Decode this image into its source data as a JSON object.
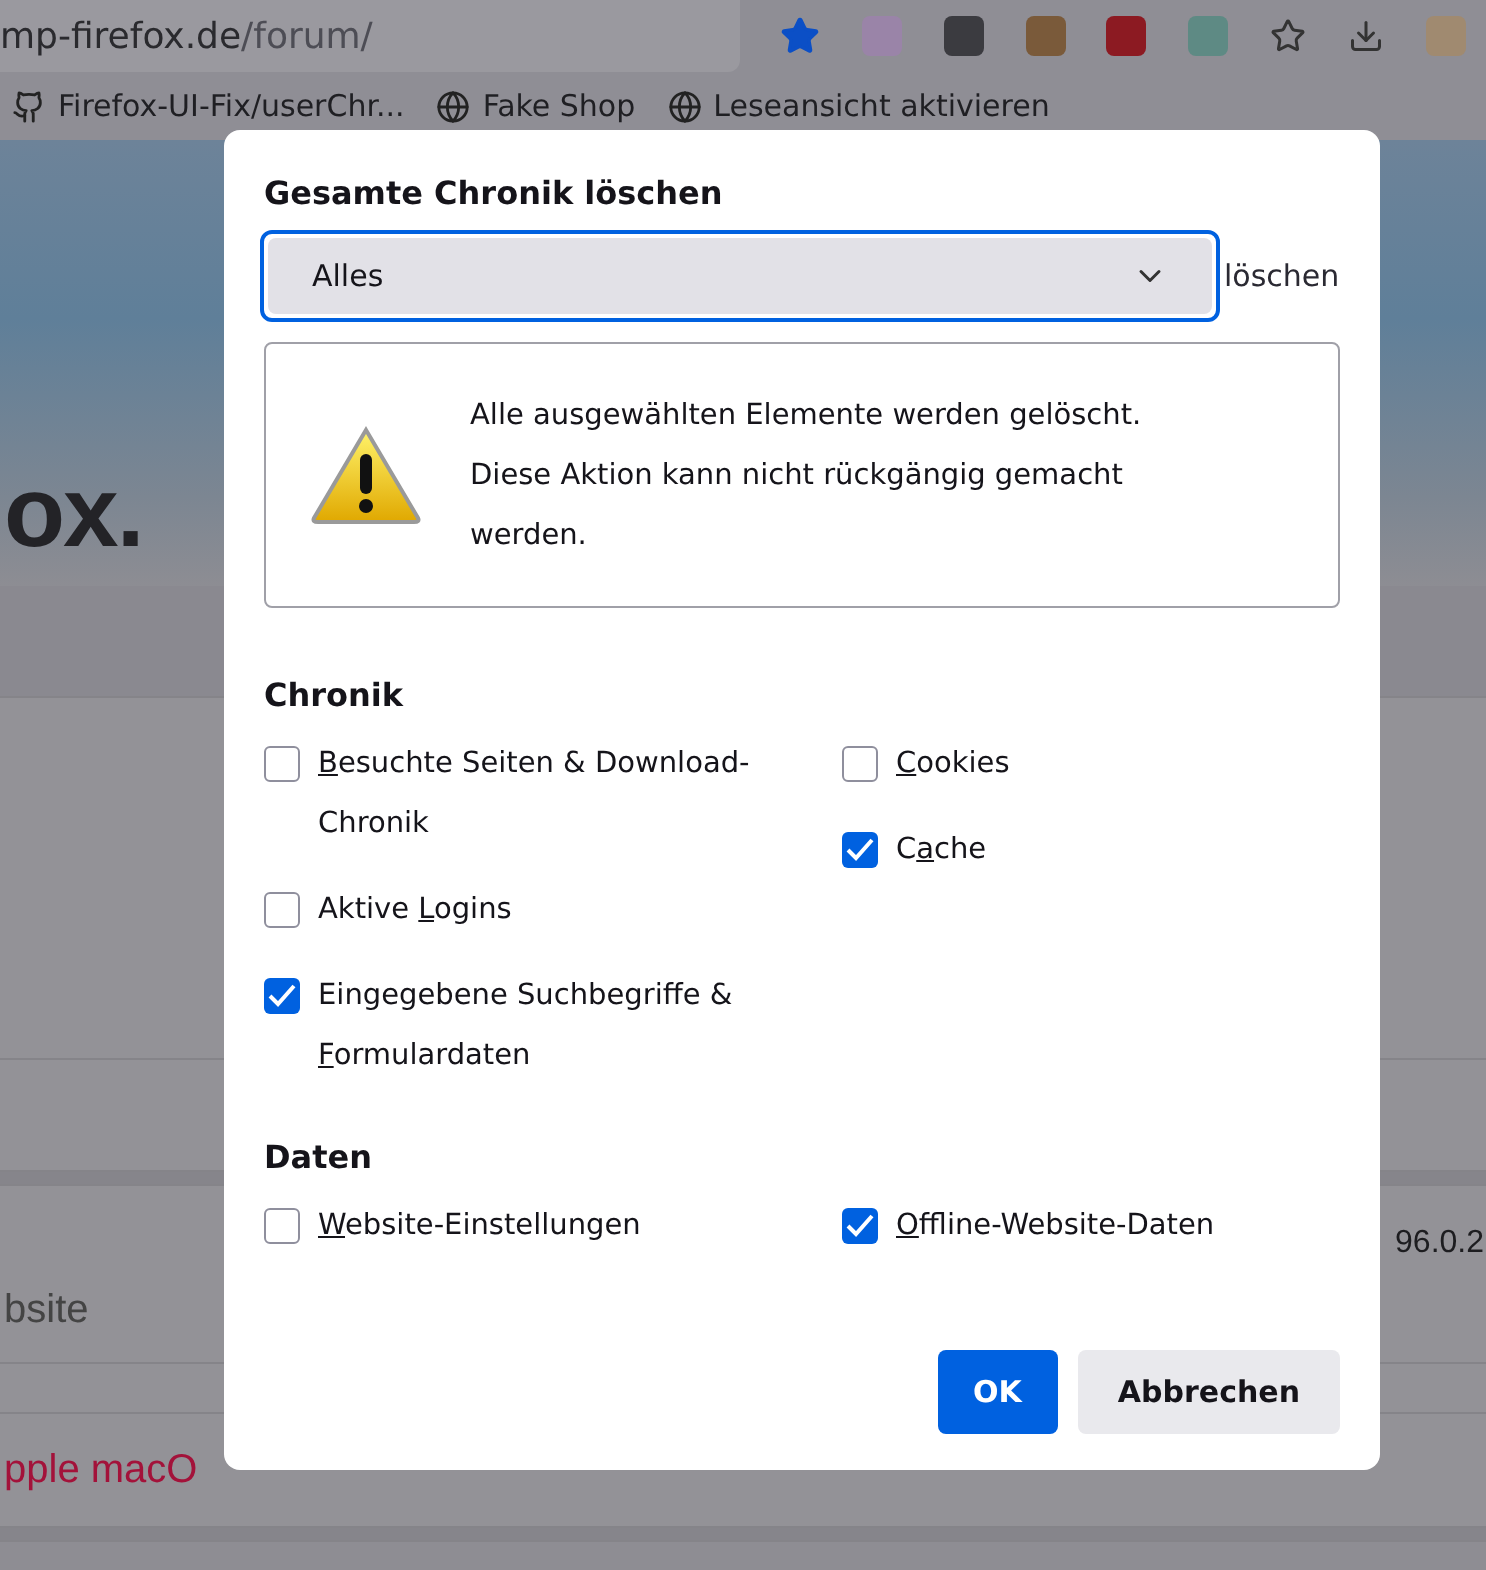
{
  "browser": {
    "url_host": "mp-firefox.de",
    "url_path": "/forum/",
    "bookmarks": [
      {
        "label": "Firefox-UI-Fix/userChr..."
      },
      {
        "label": "Fake Shop"
      },
      {
        "label": "Leseansicht aktivieren"
      }
    ]
  },
  "page": {
    "logo_text": "ox.",
    "row_label": "bsite",
    "row_value": "96.0.2",
    "link_text": "pple macO"
  },
  "dialog": {
    "title": "Gesamte Chronik löschen",
    "range": {
      "value": "Alles",
      "focused": true
    },
    "range_label_tail": "löschen",
    "warning": [
      "Alle ausgewählten Elemente werden gelöscht.",
      "Diese Aktion kann nicht rückgängig gemacht werden."
    ],
    "sections": [
      {
        "heading": "Chronik",
        "left": [
          {
            "key": "B",
            "post": "esuchte Seiten & Download-Chronik",
            "checked": false
          },
          {
            "pre": "Aktive ",
            "key": "L",
            "post": "ogins",
            "checked": false
          },
          {
            "pre": "Eingegebene Suchbegriffe & ",
            "key": "F",
            "post": "ormulardaten",
            "checked": true
          }
        ],
        "right": [
          {
            "key": "C",
            "post": "ookies",
            "checked": false
          },
          {
            "pre": "C",
            "key": "a",
            "post": "che",
            "checked": true
          }
        ]
      },
      {
        "heading": "Daten",
        "left": [
          {
            "key": "W",
            "post": "ebsite-Einstellungen",
            "checked": false
          }
        ],
        "right": [
          {
            "key": "O",
            "post": "ffline-Website-Daten",
            "checked": true
          }
        ]
      }
    ],
    "buttons": [
      {
        "label": "OK",
        "kind": "primary"
      },
      {
        "label": "Abbrechen",
        "kind": "secondary"
      }
    ]
  }
}
